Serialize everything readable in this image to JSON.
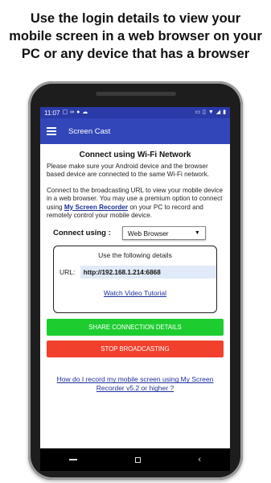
{
  "caption": {
    "line1": "Use the login details to view your",
    "line2": "mobile screen in a web browser on your",
    "line3": "PC or any device that has a browser"
  },
  "status_bar": {
    "time": "11:07",
    "left_icons": [
      "notification-icon",
      "voicemail-icon",
      "messenger-icon",
      "cloud-icon"
    ],
    "right_icons": [
      "cast-icon",
      "vibrate-icon",
      "wifi-icon",
      "signal-icon",
      "battery-icon"
    ]
  },
  "app_bar": {
    "title": "Screen Cast"
  },
  "main": {
    "heading": "Connect using Wi-Fi Network",
    "para1": "Please make sure your Android device and the browser based device are connected to the same Wi-Fi network.",
    "para2_before": "Connect to the broadcasting URL to view your mobile device in a web browser. You may use a premium option to connect using ",
    "para2_link": "My Screen Recorder",
    "para2_after": " on your PC to record and remotely control your mobile device.",
    "connect_label": "Connect using :",
    "connect_value": "Web Browser",
    "details_title": "Use the following details",
    "url_label": "URL:",
    "url_value": "http://192.168.1.214:6868",
    "video_link": "Watch Video Tutorial",
    "share_button": "SHARE CONNECTION DETAILS",
    "stop_button": "STOP BROADCASTING",
    "help_link": "How do I record my mobile screen using My Screen Recorder v5.2 or higher ?"
  },
  "colors": {
    "status_bar": "#2a3aa8",
    "app_bar": "#3346b9",
    "share_button": "#1dcd30",
    "stop_button": "#f1402c",
    "link": "#1d2f9c",
    "url_bg": "#e0eaf8"
  }
}
